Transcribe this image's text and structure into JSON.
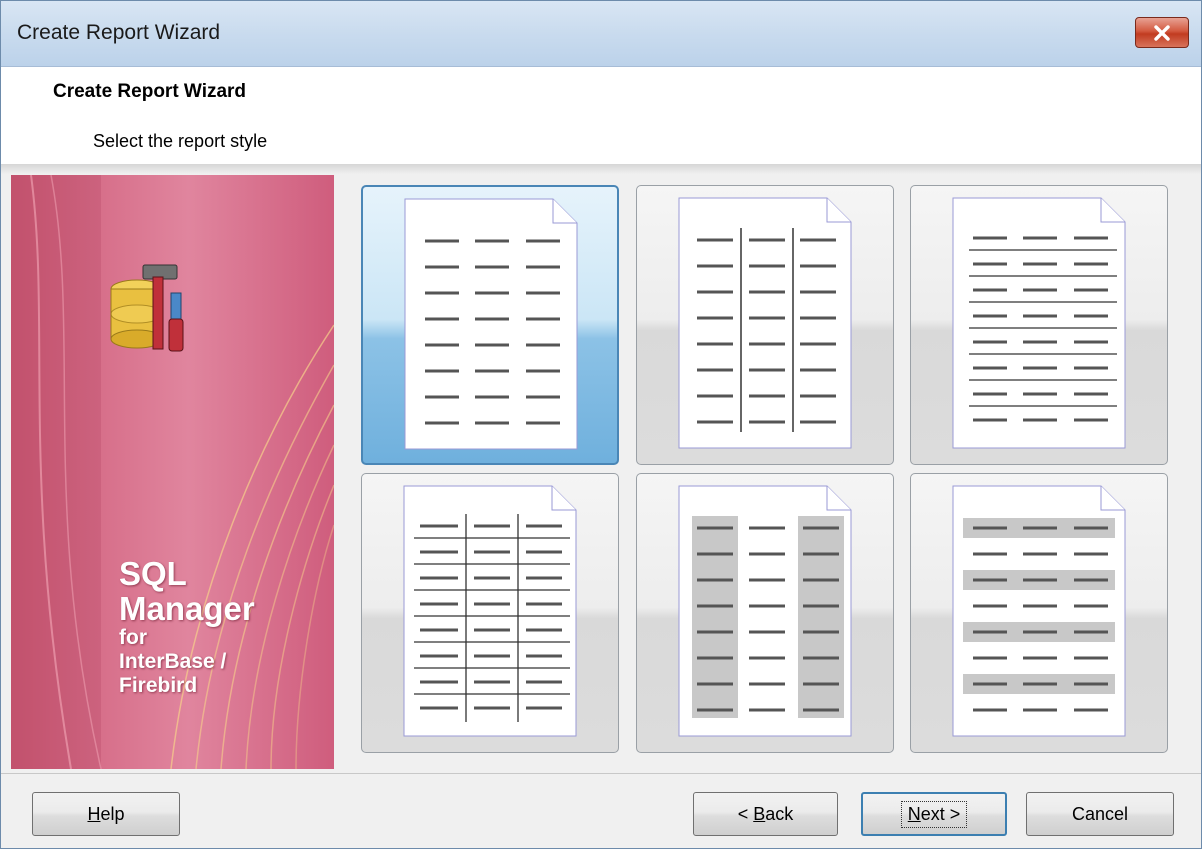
{
  "window": {
    "title": "Create Report Wizard"
  },
  "header": {
    "title": "Create Report Wizard",
    "subtitle": "Select the report style"
  },
  "banner": {
    "line1": "SQL",
    "line2": "Manager",
    "line3": "for",
    "line4": "InterBase /",
    "line5": "Firebird",
    "icon": "database-tools-icon"
  },
  "styles": [
    {
      "name": "plain",
      "selected": true
    },
    {
      "name": "columns-separated",
      "selected": false
    },
    {
      "name": "rows-separated",
      "selected": false
    },
    {
      "name": "grid",
      "selected": false
    },
    {
      "name": "shaded-columns",
      "selected": false
    },
    {
      "name": "shaded-rows",
      "selected": false
    }
  ],
  "buttons": {
    "help": {
      "mnemonic": "H",
      "rest": "elp"
    },
    "back": {
      "prefix": "< ",
      "mnemonic": "B",
      "rest": "ack"
    },
    "next": {
      "mnemonic": "N",
      "rest": "ext >"
    },
    "cancel": "Cancel"
  },
  "colors": {
    "selection": "#4a86b6",
    "banner": "#d66d88"
  }
}
